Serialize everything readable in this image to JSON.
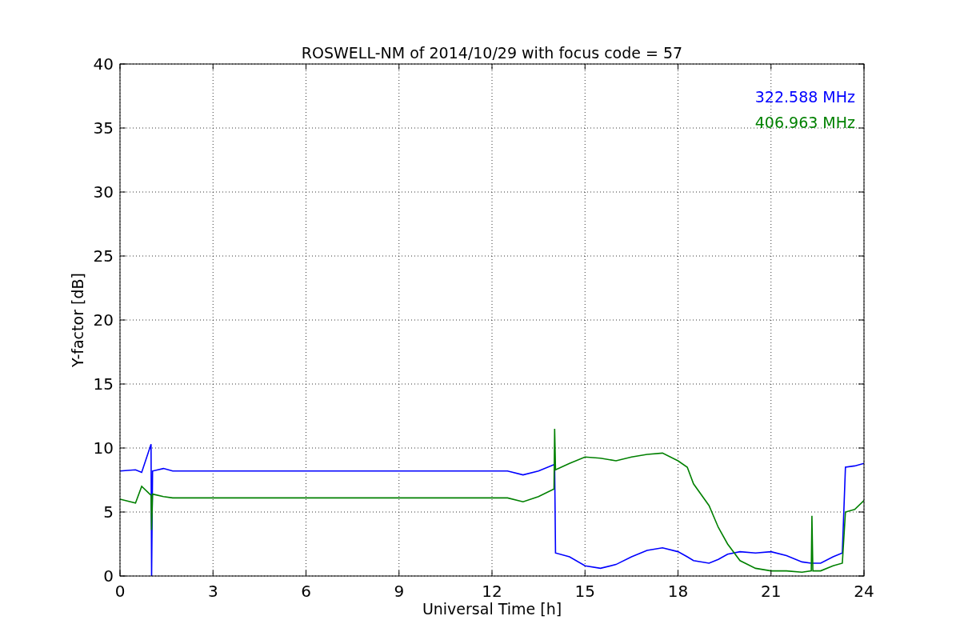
{
  "chart": {
    "chart_data": {
      "type": "line",
      "title": "ROSWELL-NM of 2014/10/29 with focus code = 57",
      "xlabel": "Universal Time [h]",
      "ylabel": "Y-factor [dB]",
      "grid": true,
      "xlim": [
        0,
        24
      ],
      "ylim": [
        0,
        40
      ],
      "xticks": [
        0,
        3,
        6,
        9,
        12,
        15,
        18,
        21,
        24
      ],
      "yticks": [
        0,
        5,
        10,
        15,
        20,
        25,
        30,
        35,
        40
      ],
      "x": [
        0,
        0.5,
        0.7,
        1.0,
        1.02,
        1.05,
        1.4,
        1.7,
        12.5,
        13,
        13.5,
        14,
        14.02,
        14.05,
        14.5,
        15,
        15.5,
        16,
        16.5,
        17,
        17.5,
        18,
        18.3,
        18.5,
        19,
        19.3,
        19.6,
        20,
        20.5,
        21,
        21.5,
        22,
        22.3,
        22.32,
        22.35,
        22.6,
        23,
        23.3,
        23.4,
        23.7,
        24
      ],
      "series": [
        {
          "name": "322.588 MHz",
          "color": "#0000ff",
          "values": [
            8.2,
            8.3,
            8.1,
            10.3,
            0,
            8.2,
            8.4,
            8.2,
            8.2,
            7.9,
            8.2,
            8.7,
            8.7,
            1.8,
            1.5,
            0.8,
            0.6,
            0.9,
            1.5,
            2.0,
            2.2,
            1.9,
            1.5,
            1.2,
            1.0,
            1.3,
            1.7,
            1.9,
            1.8,
            1.9,
            1.6,
            1.1,
            1.0,
            1.0,
            1.0,
            1.0,
            1.5,
            1.8,
            8.5,
            8.6,
            8.8
          ]
        },
        {
          "name": "406.963 MHz",
          "color": "#008000",
          "values": [
            6.0,
            5.7,
            7.0,
            6.3,
            3.6,
            6.4,
            6.2,
            6.1,
            6.1,
            5.8,
            6.2,
            6.8,
            11.5,
            8.3,
            8.8,
            9.3,
            9.2,
            9.0,
            9.3,
            9.5,
            9.6,
            9.0,
            8.5,
            7.2,
            5.5,
            3.8,
            2.5,
            1.2,
            0.6,
            0.4,
            0.4,
            0.3,
            0.4,
            4.7,
            0.4,
            0.4,
            0.8,
            1.0,
            5.0,
            5.2,
            5.9
          ]
        }
      ]
    }
  }
}
